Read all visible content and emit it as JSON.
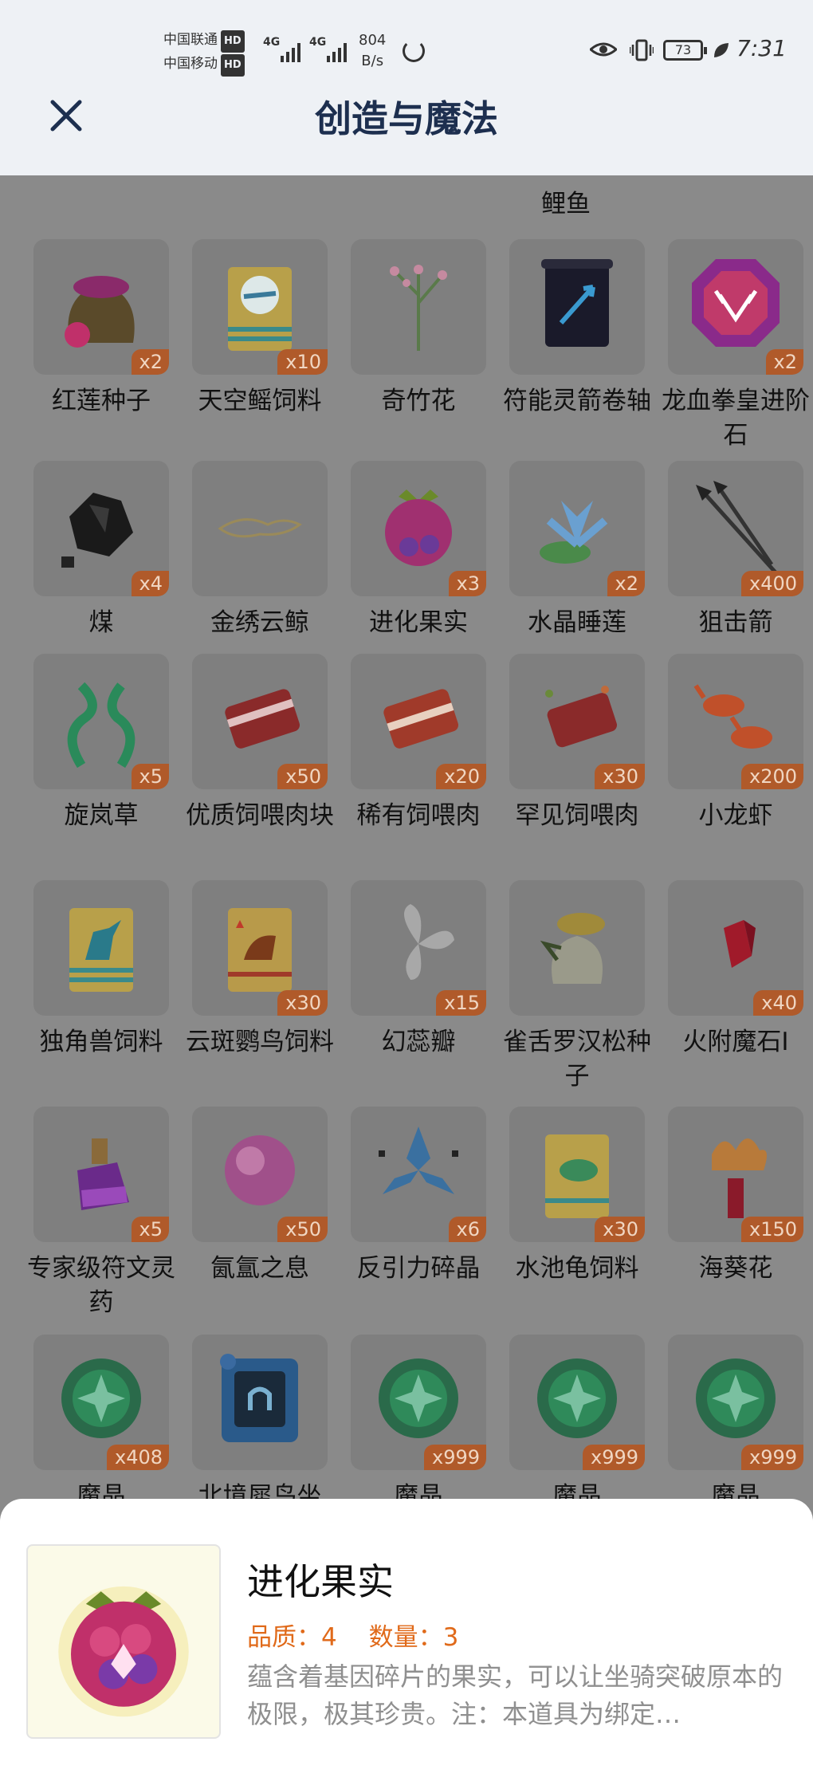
{
  "status_bar": {
    "carrier1": "中国联通",
    "carrier2": "中国移动",
    "hd": "HD",
    "sig1": "4G",
    "sig2": "4G",
    "speed_value": "804",
    "speed_unit": "B/s",
    "battery": "73",
    "time": "7:31"
  },
  "header": {
    "title": "创造与魔法"
  },
  "grid": {
    "top_partial_label": "鲤鱼",
    "items": [
      {
        "name": "红莲种子",
        "badge": "x2",
        "icon": "red-lotus-seed-bag-icon"
      },
      {
        "name": "天空鳐饲料",
        "badge": "x10",
        "icon": "sky-ray-feed-bag-icon"
      },
      {
        "name": "奇竹花",
        "badge": "",
        "icon": "bamboo-flower-icon"
      },
      {
        "name": "符能灵箭卷轴",
        "badge": "",
        "icon": "arrow-scroll-icon"
      },
      {
        "name": "龙血拳皇进阶石",
        "badge": "x2",
        "icon": "dragon-blood-stone-icon"
      },
      {
        "name": "煤",
        "badge": "x4",
        "icon": "coal-icon"
      },
      {
        "name": "金绣云鲸",
        "badge": "",
        "icon": "gold-cloud-whale-icon"
      },
      {
        "name": "进化果实",
        "badge": "x3",
        "icon": "evolution-fruit-icon"
      },
      {
        "name": "水晶睡莲",
        "badge": "x2",
        "icon": "crystal-lotus-icon"
      },
      {
        "name": "狙击箭",
        "badge": "x400",
        "icon": "sniper-arrow-icon"
      },
      {
        "name": "旋岚草",
        "badge": "x5",
        "icon": "whirl-grass-icon"
      },
      {
        "name": "优质饲喂肉块",
        "badge": "x50",
        "icon": "quality-meat-icon"
      },
      {
        "name": "稀有饲喂肉",
        "badge": "x20",
        "icon": "rare-meat-icon"
      },
      {
        "name": "罕见饲喂肉",
        "badge": "x30",
        "icon": "uncommon-meat-icon"
      },
      {
        "name": "小龙虾",
        "badge": "x200",
        "icon": "crayfish-icon"
      },
      {
        "name": "独角兽饲料",
        "badge": "",
        "icon": "unicorn-feed-bag-icon"
      },
      {
        "name": "云斑鹦鸟饲料",
        "badge": "x30",
        "icon": "parrot-feed-bag-icon"
      },
      {
        "name": "幻蕊瓣",
        "badge": "x15",
        "icon": "phantom-petal-icon"
      },
      {
        "name": "雀舌罗汉松种子",
        "badge": "",
        "icon": "pine-seed-bag-icon"
      },
      {
        "name": "火附魔石I",
        "badge": "x40",
        "icon": "fire-enchant-stone-icon"
      },
      {
        "name": "专家级符文灵药",
        "badge": "x5",
        "icon": "rune-potion-icon"
      },
      {
        "name": "氤氲之息",
        "badge": "x50",
        "icon": "mist-orb-icon"
      },
      {
        "name": "反引力碎晶",
        "badge": "x6",
        "icon": "antigravity-crystal-icon"
      },
      {
        "name": "水池龟饲料",
        "badge": "x30",
        "icon": "turtle-feed-bag-icon"
      },
      {
        "name": "海葵花",
        "badge": "x150",
        "icon": "anemone-flower-icon"
      },
      {
        "name": "魔晶",
        "badge": "x408",
        "icon": "magic-crystal-icon"
      },
      {
        "name": "北境犀鸟坐",
        "badge": "",
        "icon": "hornbill-mount-card-icon"
      },
      {
        "name": "魔晶",
        "badge": "x999",
        "icon": "magic-crystal-icon"
      },
      {
        "name": "魔晶",
        "badge": "x999",
        "icon": "magic-crystal-icon"
      },
      {
        "name": "魔晶",
        "badge": "x999",
        "icon": "magic-crystal-icon"
      }
    ]
  },
  "detail": {
    "title": "进化果实",
    "quality": "品质：4",
    "quantity": "数量：3",
    "description": "蕴含着基因碎片的果实，可以让坐骑突破原本的极限，极其珍贵。注：本道具为绑定…"
  },
  "colors": {
    "accent_orange": "#e06a1a",
    "badge_bg": "#b05a2a",
    "title_navy": "#1d2f4f"
  }
}
